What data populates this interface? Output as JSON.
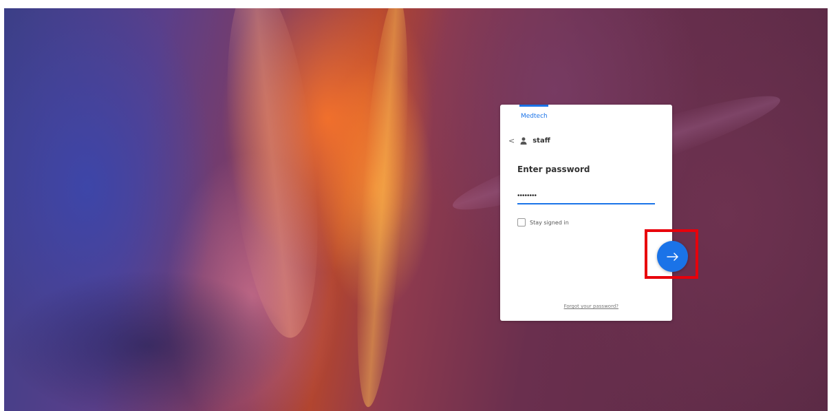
{
  "login": {
    "brand": "Medtech",
    "username": "staff",
    "title": "Enter password",
    "password_value": "••••••••",
    "stay_signed_in_label": "Stay signed in",
    "forgot_link": "Forgot your password?"
  },
  "icons": {
    "back": "chevron-left-icon",
    "user": "user-icon",
    "submit": "arrow-right-icon"
  },
  "colors": {
    "accent": "#1a73e8",
    "highlight": "#e8000b",
    "card_bg": "#ffffff"
  }
}
